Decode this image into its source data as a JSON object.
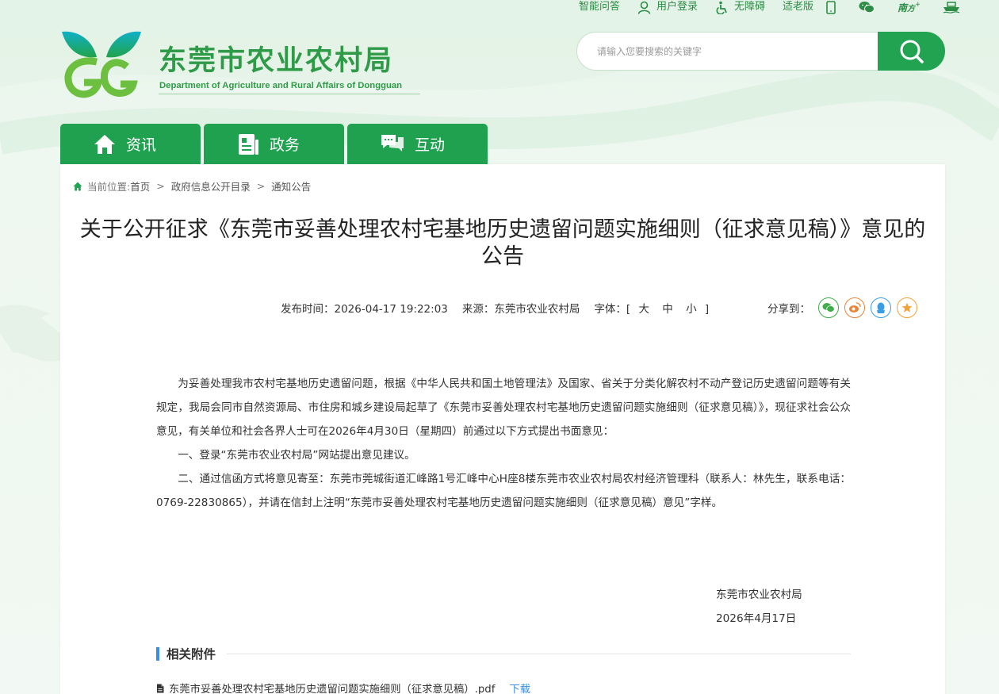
{
  "topbar": {
    "smart_qa": "智能问答",
    "login": "用户登录",
    "accessible": "无障碍",
    "elderly": "适老版"
  },
  "logo": {
    "name_cn": "东莞市农业农村局",
    "name_en": "Department of Agriculture and Rural Affairs of Dongguan"
  },
  "search": {
    "placeholder": "请输入您要搜索的关键字"
  },
  "nav": {
    "tabs": [
      {
        "label": "资讯"
      },
      {
        "label": "政务"
      },
      {
        "label": "互动"
      }
    ]
  },
  "breadcrumb": {
    "current_label": "当前位置:",
    "home": "首页",
    "sep": ">",
    "level1": "政府信息公开目录",
    "level2": "通知公告"
  },
  "article": {
    "title": "关于公开征求《东莞市妥善处理农村宅基地历史遗留问题实施细则（征求意见稿）》意见的公告",
    "publish_time": "发布时间：2026-04-17 19:22:03",
    "source": "来源：东莞市农业农村局",
    "font_label": "字体：[",
    "font_close": "]",
    "font_large": "大",
    "font_medium": "中",
    "font_small": "小",
    "share_label": "分享到：",
    "paragraphs": [
      "为妥善处理我市农村宅基地历史遗留问题，根据《中华人民共和国土地管理法》及国家、省关于分类化解农村不动产登记历史遗留问题等有关规定，我局会同市自然资源局、市住房和城乡建设局起草了《东莞市妥善处理农村宅基地历史遗留问题实施细则（征求意见稿）》，现征求社会公众意见，有关单位和社会各界人士可在2026年4月30日（星期四）前通过以下方式提出书面意见：",
      "一、登录“东莞市农业农村局”网站提出意见建议。",
      "二、通过信函方式将意见寄至：东莞市莞城街道汇峰路1号汇峰中心H座8楼东莞市农业农村局农村经济管理科（联系人：林先生，联系电话：0769-22830865），并请在信封上注明“东莞市妥善处理农村宅基地历史遗留问题实施细则（征求意见稿）意见”字样。"
    ],
    "sign_org": "东莞市农业农村局",
    "sign_date": "2026年4月17日"
  },
  "attachments": {
    "heading": "相关附件",
    "items": [
      {
        "name": "东莞市妥善处理农村宅基地历史遗留问题实施细则（征求意见稿）.pdf",
        "download": "下载"
      }
    ]
  },
  "colors": {
    "brand_green": "#20a150",
    "link_blue": "#3a8ee6"
  }
}
